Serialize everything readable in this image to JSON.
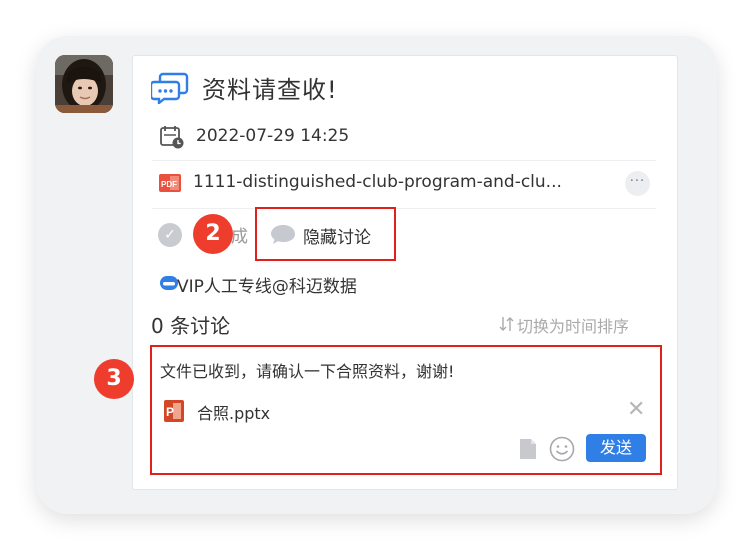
{
  "task": {
    "title": "资料请查收!",
    "datetime": "2022-07-29 14:25",
    "attachment_name": "1111-distinguished-club-program-and-clu...",
    "more_label": "···",
    "done_label": "成",
    "hide_discussion_label": "隐藏讨论",
    "source_label": "VIP人工专线@科迈数据"
  },
  "discussion": {
    "count_label": "0 条讨论",
    "sort_toggle_label": "切换为时间排序"
  },
  "reply": {
    "text": "文件已收到，请确认一下合照资料，谢谢!",
    "attachment_name": "合照.pptx",
    "send_label": "发送"
  },
  "callouts": {
    "badge_2": "2",
    "badge_3": "3"
  },
  "colors": {
    "accent_blue": "#2f7fe6",
    "callout_red": "#ee3c2d",
    "highlight_border": "#e0201b"
  }
}
